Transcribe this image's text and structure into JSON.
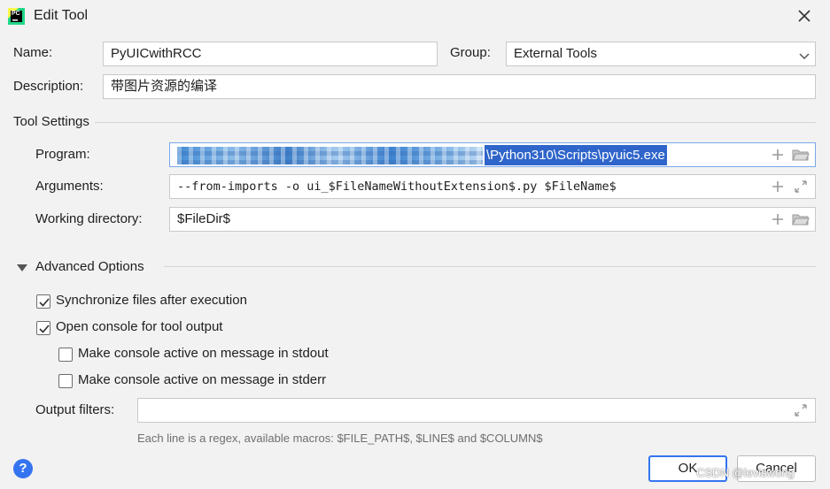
{
  "window": {
    "title": "Edit Tool",
    "app_icon_text": "PC"
  },
  "form": {
    "name_label": "Name:",
    "name_value": "PyUICwithRCC",
    "group_label": "Group:",
    "group_value": "External Tools",
    "description_label": "Description:",
    "description_value": "带图片资源的编译"
  },
  "tool_settings": {
    "title": "Tool Settings",
    "program_label": "Program:",
    "program_value_visible": "\\Python310\\Scripts\\pyuic5.exe",
    "arguments_label": "Arguments:",
    "arguments_value": "--from-imports -o ui_$FileNameWithoutExtension$.py $FileName$",
    "working_dir_label": "Working directory:",
    "working_dir_value": "$FileDir$"
  },
  "advanced": {
    "title": "Advanced Options",
    "options": [
      {
        "label": "Synchronize files after execution",
        "checked": true
      },
      {
        "label": "Open console for tool output",
        "checked": true
      },
      {
        "label": "Make console active on message in stdout",
        "checked": false
      },
      {
        "label": "Make console active on message in stderr",
        "checked": false
      }
    ],
    "output_filters_label": "Output filters:",
    "output_filters_value": "",
    "hint": "Each line is a regex, available macros: $FILE_PATH$, $LINE$ and $COLUMN$"
  },
  "buttons": {
    "ok": "OK",
    "cancel": "Cancel",
    "help": "?"
  },
  "watermark": "CSDN @leviswong",
  "colors": {
    "accent": "#3574f0",
    "selection": "#2f65ca",
    "background": "#f2f2f2"
  }
}
